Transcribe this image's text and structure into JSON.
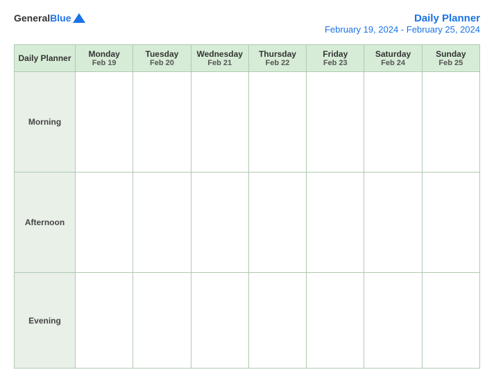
{
  "header": {
    "logo": {
      "text_general": "General",
      "text_blue": "Blue"
    },
    "title": "Daily Planner",
    "date_range": "February 19, 2024 - February 25, 2024"
  },
  "table": {
    "first_col_header": "Daily Planner",
    "days": [
      {
        "name": "Monday",
        "date": "Feb 19"
      },
      {
        "name": "Tuesday",
        "date": "Feb 20"
      },
      {
        "name": "Wednesday",
        "date": "Feb 21"
      },
      {
        "name": "Thursday",
        "date": "Feb 22"
      },
      {
        "name": "Friday",
        "date": "Feb 23"
      },
      {
        "name": "Saturday",
        "date": "Feb 24"
      },
      {
        "name": "Sunday",
        "date": "Feb 25"
      }
    ],
    "rows": [
      {
        "label": "Morning"
      },
      {
        "label": "Afternoon"
      },
      {
        "label": "Evening"
      }
    ]
  }
}
